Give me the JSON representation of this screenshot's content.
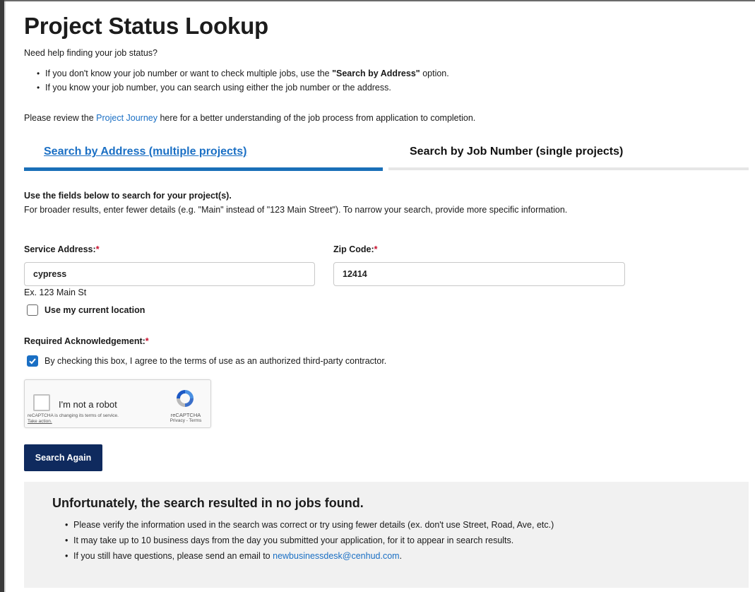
{
  "page": {
    "title": "Project Status Lookup",
    "intro": "Need help finding your job status?",
    "bullets": {
      "b1_pre": "If you don't know your job number or want to check multiple jobs, use the ",
      "b1_bold": "\"Search by Address\"",
      "b1_post": " option.",
      "b2": "If you know your job number, you can search using either the job number or the address."
    },
    "journey": {
      "pre": "Please review the ",
      "link": "Project Journey",
      "post": " here for a better understanding of the job process from application to completion."
    }
  },
  "tabs": {
    "address": "Search by Address (multiple projects)",
    "job": "Search by Job Number (single projects)"
  },
  "form": {
    "instructions_title": "Use the fields below to search for your project(s).",
    "instructions_body": "For broader results, enter fewer details (e.g. \"Main\" instead of \"123 Main Street\"). To narrow your search, provide more specific information.",
    "service_address_label": "Service Address:",
    "service_address_value": "cypress",
    "service_address_hint": "Ex. 123 Main St",
    "zip_label": "Zip Code:",
    "zip_value": "12414",
    "required_marker": "*",
    "use_location_label": "Use my current location",
    "use_location_checked": false,
    "ack_label": "Required Acknowledgement:",
    "ack_text": "By checking this box, I agree to the terms of use as an authorized third-party contractor.",
    "ack_checked": true,
    "search_button": "Search Again"
  },
  "captcha": {
    "label": "I'm not a robot",
    "notice": "reCAPTCHA is changing its terms of service.",
    "action": "Take action.",
    "brand": "reCAPTCHA",
    "links": "Privacy - Terms"
  },
  "results": {
    "heading": "Unfortunately, the search resulted in no jobs found.",
    "item1": "Please verify the information used in the search was correct or try using fewer details (ex. don't use Street, Road, Ave, etc.)",
    "item2": "It may take up to 10 business days from the day you submitted your application, for it to appear in search results.",
    "item3_pre": "If you still have questions, please send an email to ",
    "item3_email": "newbusinessdesk@cenhud.com",
    "item3_post": "."
  },
  "colors": {
    "link": "#1a6fc4",
    "button": "#0f2a5e",
    "required": "#c8102e",
    "active_tab_bar": "#1a6fb8"
  }
}
